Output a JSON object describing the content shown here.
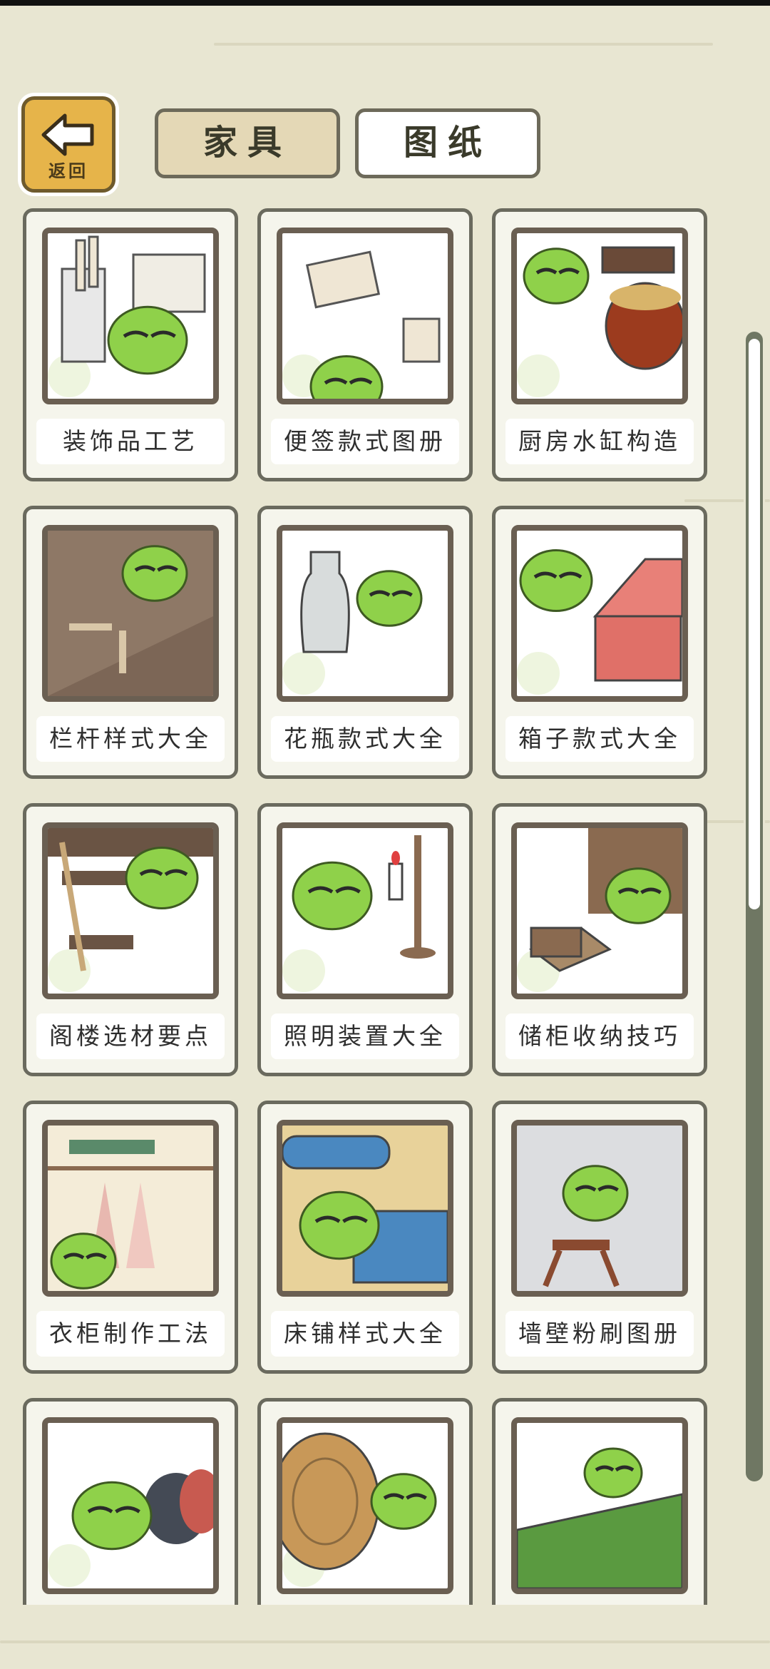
{
  "header": {
    "back_label": "返回",
    "tabs": [
      {
        "label": "家具",
        "active": true
      },
      {
        "label": "图纸",
        "active": false
      }
    ]
  },
  "colors": {
    "background": "#e8e6d2",
    "back_button": "#e6b44a",
    "active_tab": "#e4d8b6",
    "frog_green": "#8fd14a",
    "scroll_track": "#6f7763"
  },
  "items": [
    {
      "label": "装饰品工艺",
      "icon": "frog-with-scrolls-icon"
    },
    {
      "label": "便签款式图册",
      "icon": "frog-with-notes-icon"
    },
    {
      "label": "厨房水缸构造",
      "icon": "frog-with-water-jar-icon"
    },
    {
      "label": "栏杆样式大全",
      "icon": "frog-with-railing-icon"
    },
    {
      "label": "花瓶款式大全",
      "icon": "frog-with-vase-icon"
    },
    {
      "label": "箱子款式大全",
      "icon": "frog-with-chest-icon"
    },
    {
      "label": "阁楼选材要点",
      "icon": "frog-with-ladder-icon"
    },
    {
      "label": "照明装置大全",
      "icon": "frog-with-candle-icon"
    },
    {
      "label": "储柜收纳技巧",
      "icon": "frog-with-box-icon"
    },
    {
      "label": "衣柜制作工法",
      "icon": "frog-with-wardrobe-icon"
    },
    {
      "label": "床铺样式大全",
      "icon": "frog-with-bed-icon"
    },
    {
      "label": "墙壁粉刷图册",
      "icon": "frog-painting-wall-icon"
    },
    {
      "label": "",
      "icon": "frog-with-cushion-icon"
    },
    {
      "label": "",
      "icon": "frog-with-wood-icon"
    },
    {
      "label": "",
      "icon": "frog-with-rug-icon"
    }
  ]
}
